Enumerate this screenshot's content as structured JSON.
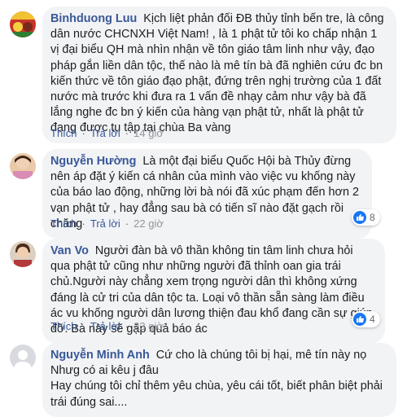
{
  "comments": [
    {
      "author": "Binhduong Luu",
      "text": "Kịch liệt phản đối ĐB thủy tỉnh bến tre, là công dân nước CHCNXH Việt Nam! , là 1 phật tử tôi ko chấp nhận 1 vị đại biểu QH mà nhìn nhận về tôn giáo tâm linh như vậy, đạo pháp gắn liền dân tộc, thế nào là mê tín bà đã nghiên cứu đc bn kiến thức về tôn giáo đạo phật, đứng trên nghị trường của 1 đất nước mà trước khi đưa ra 1 vấn đề nhạy cảm như vậy bà đã lắng nghe đc bn ý kiến của hàng vạn phật tử, nhất là phật tử đang được tu tập tại chùa Ba vàng",
      "like": "Thích",
      "reply": "Trả lời",
      "time": "14 giờ"
    },
    {
      "author": "Nguyễn Hường",
      "text": "Là một đại biểu Quốc Hội bà Thủy đừng nên áp đặt ý kiến cá nhân của mình vào việc vu khống này của báo lao động, những lời bà nói đã xúc phạm đến hơn 2 vạn phật tử , hay đẳng sau bà có tiến sĩ nào đặt gạch rồi chăng",
      "like": "Thích",
      "reply": "Trả lời",
      "time": "22 giờ",
      "reaction_count": "8"
    },
    {
      "author": "Van Vo",
      "text": "Người đàn bà vô thần không tin tâm linh chưa hỏi qua phật tử cũng như những người đã thỉnh oan gia trái chủ.Người này chẳng xem trọng người dân thì không xứng đáng là cử tri của dân tộc ta. Loại vô thần sẵn sàng làm điều ác vu khống người dân lương thiện đau khổ đang cần sự giúp đỡ. Bà này sẽ gặp quả báo ác",
      "like": "Thích",
      "reply": "Trả lời",
      "time": "23 giờ",
      "reaction_count": "4"
    },
    {
      "author": "Nguyễn Minh Anh",
      "text_lines": [
        "Cứ cho là chúng tôi bị hại, mê tín này nọ",
        "Nhưg có ai kêu j đâu",
        "Hay chúng tôi chỉ thêm yêu chùa, yêu cái tốt, biết phân biệt phải trái đúng sai...."
      ]
    }
  ],
  "colors": {
    "author": "#385898",
    "bubble": "#f2f3f5",
    "like_badge": "#1877f2",
    "meta": "#90949c"
  },
  "icons": [
    "like-icon"
  ]
}
